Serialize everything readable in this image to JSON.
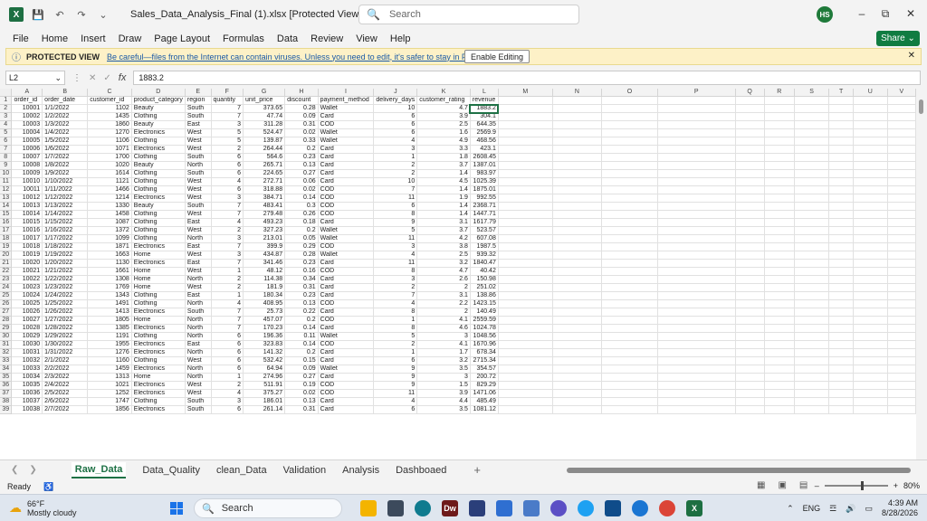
{
  "titlebar": {
    "doc_title": "Sales_Data_Analysis_Final (1).xlsx  [Protected View]  -  Excel",
    "search_placeholder": "Search",
    "avatar_initials": "HS"
  },
  "menu": [
    "File",
    "Home",
    "Insert",
    "Draw",
    "Page Layout",
    "Formulas",
    "Data",
    "Review",
    "View",
    "Help"
  ],
  "share_label": "Share",
  "protected_view": {
    "title": "PROTECTED VIEW",
    "message": "Be careful—files from the Internet can contain viruses. Unless you need to edit, it's safer to stay in Protected View.",
    "enable_label": "Enable Editing"
  },
  "formula_bar": {
    "name_box": "L2",
    "fx": "fx",
    "value": "1883.2"
  },
  "columns": [
    "A",
    "B",
    "C",
    "D",
    "E",
    "F",
    "G",
    "H",
    "I",
    "J",
    "K",
    "L",
    "M",
    "N",
    "O",
    "P",
    "Q",
    "R",
    "S",
    "T",
    "U",
    "V"
  ],
  "headers": [
    "order_id",
    "order_date",
    "customer_id",
    "product_category",
    "region",
    "quantity",
    "unit_price",
    "discount",
    "payment_method",
    "delivery_days",
    "customer_rating",
    "revenue"
  ],
  "rows": [
    [
      "10001",
      "1/1/2022",
      "1102",
      "Beauty",
      "South",
      "7",
      "373.65",
      "0.28",
      "Wallet",
      "10",
      "4.7",
      "1883.2"
    ],
    [
      "10002",
      "1/2/2022",
      "1435",
      "Clothing",
      "South",
      "7",
      "47.74",
      "0.09",
      "Card",
      "6",
      "3.9",
      "304.1"
    ],
    [
      "10003",
      "1/3/2022",
      "1860",
      "Beauty",
      "East",
      "3",
      "311.28",
      "0.31",
      "COD",
      "6",
      "2.5",
      "644.35"
    ],
    [
      "10004",
      "1/4/2022",
      "1270",
      "Electronics",
      "West",
      "5",
      "524.47",
      "0.02",
      "Wallet",
      "6",
      "1.6",
      "2569.9"
    ],
    [
      "10005",
      "1/5/2022",
      "1106",
      "Clothing",
      "West",
      "5",
      "139.87",
      "0.33",
      "Wallet",
      "4",
      "4.9",
      "468.56"
    ],
    [
      "10006",
      "1/6/2022",
      "1071",
      "Electronics",
      "West",
      "2",
      "264.44",
      "0.2",
      "Card",
      "3",
      "3.3",
      "423.1"
    ],
    [
      "10007",
      "1/7/2022",
      "1700",
      "Clothing",
      "South",
      "6",
      "564.6",
      "0.23",
      "Card",
      "1",
      "1.8",
      "2608.45"
    ],
    [
      "10008",
      "1/8/2022",
      "1020",
      "Beauty",
      "North",
      "6",
      "265.71",
      "0.13",
      "Card",
      "2",
      "3.7",
      "1387.01"
    ],
    [
      "10009",
      "1/9/2022",
      "1614",
      "Clothing",
      "South",
      "6",
      "224.65",
      "0.27",
      "Card",
      "2",
      "1.4",
      "983.97"
    ],
    [
      "10010",
      "1/10/2022",
      "1121",
      "Clothing",
      "West",
      "4",
      "272.71",
      "0.06",
      "Card",
      "10",
      "4.5",
      "1025.39"
    ],
    [
      "10011",
      "1/11/2022",
      "1466",
      "Clothing",
      "West",
      "6",
      "318.88",
      "0.02",
      "COD",
      "7",
      "1.4",
      "1875.01"
    ],
    [
      "10012",
      "1/12/2022",
      "1214",
      "Electronics",
      "West",
      "3",
      "384.71",
      "0.14",
      "COD",
      "11",
      "1.9",
      "992.55"
    ],
    [
      "10013",
      "1/13/2022",
      "1330",
      "Beauty",
      "South",
      "7",
      "483.41",
      "0.3",
      "COD",
      "6",
      "1.4",
      "2368.71"
    ],
    [
      "10014",
      "1/14/2022",
      "1458",
      "Clothing",
      "West",
      "7",
      "279.48",
      "0.26",
      "COD",
      "8",
      "1.4",
      "1447.71"
    ],
    [
      "10015",
      "1/15/2022",
      "1087",
      "Clothing",
      "East",
      "4",
      "493.23",
      "0.18",
      "Card",
      "9",
      "3.1",
      "1617.79"
    ],
    [
      "10016",
      "1/16/2022",
      "1372",
      "Clothing",
      "West",
      "2",
      "327.23",
      "0.2",
      "Wallet",
      "5",
      "3.7",
      "523.57"
    ],
    [
      "10017",
      "1/17/2022",
      "1099",
      "Clothing",
      "North",
      "3",
      "213.01",
      "0.05",
      "Wallet",
      "11",
      "4.2",
      "607.08"
    ],
    [
      "10018",
      "1/18/2022",
      "1871",
      "Electronics",
      "East",
      "7",
      "399.9",
      "0.29",
      "COD",
      "3",
      "3.8",
      "1987.5"
    ],
    [
      "10019",
      "1/19/2022",
      "1663",
      "Home",
      "West",
      "3",
      "434.87",
      "0.28",
      "Wallet",
      "4",
      "2.5",
      "939.32"
    ],
    [
      "10020",
      "1/20/2022",
      "1130",
      "Electronics",
      "East",
      "7",
      "341.46",
      "0.23",
      "Card",
      "11",
      "3.2",
      "1840.47"
    ],
    [
      "10021",
      "1/21/2022",
      "1661",
      "Home",
      "West",
      "1",
      "48.12",
      "0.16",
      "COD",
      "8",
      "4.7",
      "40.42"
    ],
    [
      "10022",
      "1/22/2022",
      "1308",
      "Home",
      "North",
      "2",
      "114.38",
      "0.34",
      "Card",
      "3",
      "2.6",
      "150.98"
    ],
    [
      "10023",
      "1/23/2022",
      "1769",
      "Home",
      "West",
      "2",
      "181.9",
      "0.31",
      "Card",
      "2",
      "2",
      "251.02"
    ],
    [
      "10024",
      "1/24/2022",
      "1343",
      "Clothing",
      "East",
      "1",
      "180.34",
      "0.23",
      "Card",
      "7",
      "3.1",
      "138.86"
    ],
    [
      "10025",
      "1/25/2022",
      "1491",
      "Clothing",
      "North",
      "4",
      "408.95",
      "0.13",
      "COD",
      "4",
      "2.2",
      "1423.15"
    ],
    [
      "10026",
      "1/26/2022",
      "1413",
      "Electronics",
      "South",
      "7",
      "25.73",
      "0.22",
      "Card",
      "8",
      "2",
      "140.49"
    ],
    [
      "10027",
      "1/27/2022",
      "1805",
      "Home",
      "North",
      "7",
      "457.07",
      "0.2",
      "COD",
      "1",
      "4.1",
      "2559.59"
    ],
    [
      "10028",
      "1/28/2022",
      "1385",
      "Electronics",
      "North",
      "7",
      "170.23",
      "0.14",
      "Card",
      "8",
      "4.6",
      "1024.78"
    ],
    [
      "10029",
      "1/29/2022",
      "1191",
      "Clothing",
      "North",
      "6",
      "196.36",
      "0.11",
      "Wallet",
      "5",
      "3",
      "1048.56"
    ],
    [
      "10030",
      "1/30/2022",
      "1955",
      "Electronics",
      "East",
      "6",
      "323.83",
      "0.14",
      "COD",
      "2",
      "4.1",
      "1670.96"
    ],
    [
      "10031",
      "1/31/2022",
      "1276",
      "Electronics",
      "North",
      "6",
      "141.32",
      "0.2",
      "Card",
      "1",
      "1.7",
      "678.34"
    ],
    [
      "10032",
      "2/1/2022",
      "1160",
      "Clothing",
      "West",
      "6",
      "532.42",
      "0.15",
      "Card",
      "6",
      "3.2",
      "2715.34"
    ],
    [
      "10033",
      "2/2/2022",
      "1459",
      "Electronics",
      "North",
      "6",
      "64.94",
      "0.09",
      "Wallet",
      "9",
      "3.5",
      "354.57"
    ],
    [
      "10034",
      "2/3/2022",
      "1313",
      "Home",
      "North",
      "1",
      "274.96",
      "0.27",
      "Card",
      "9",
      "3",
      "200.72"
    ],
    [
      "10035",
      "2/4/2022",
      "1021",
      "Electronics",
      "West",
      "2",
      "511.91",
      "0.19",
      "COD",
      "9",
      "1.5",
      "829.29"
    ],
    [
      "10036",
      "2/5/2022",
      "1252",
      "Electronics",
      "West",
      "4",
      "375.27",
      "0.02",
      "COD",
      "11",
      "3.9",
      "1471.06"
    ],
    [
      "10037",
      "2/6/2022",
      "1747",
      "Clothing",
      "South",
      "3",
      "186.01",
      "0.13",
      "Card",
      "4",
      "4.4",
      "485.49"
    ],
    [
      "10038",
      "2/7/2022",
      "1856",
      "Electronics",
      "South",
      "6",
      "261.14",
      "0.31",
      "Card",
      "6",
      "3.5",
      "1081.12"
    ]
  ],
  "sheet_tabs": [
    "Raw_Data",
    "Data_Quality",
    "clean_Data",
    "Validation",
    "Analysis",
    "Dashboaed"
  ],
  "active_sheet": "Raw_Data",
  "status": {
    "ready": "Ready",
    "zoom": "80%"
  },
  "taskbar": {
    "weather_temp": "66°F",
    "weather_desc": "Mostly cloudy",
    "search_label": "Search",
    "lang": "ENG",
    "time": "4:39 AM",
    "date": "8/28/2026"
  }
}
